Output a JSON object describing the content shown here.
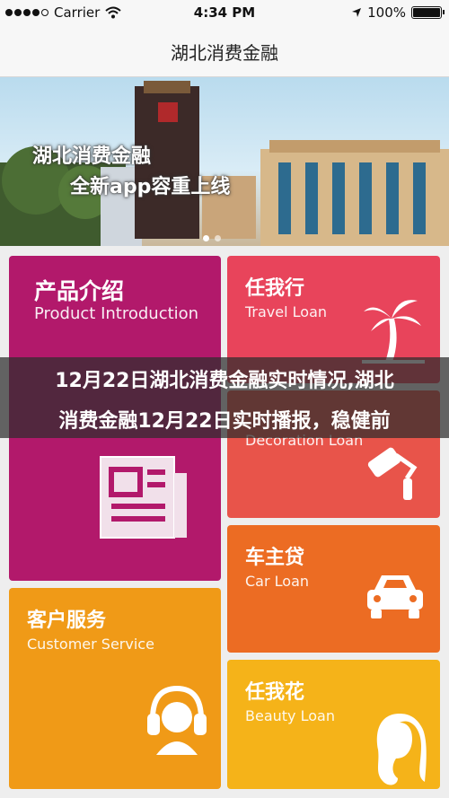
{
  "status_bar": {
    "carrier": "Carrier",
    "time": "4:34 PM",
    "battery": "100%"
  },
  "nav": {
    "title": "湖北消费金融"
  },
  "banner": {
    "line1": "湖北消费金融",
    "line2": "全新app容重上线"
  },
  "tiles": {
    "product": {
      "zh": "产品介绍",
      "en": "Product Introduction"
    },
    "travel": {
      "zh": "任我行",
      "en": "Travel Loan"
    },
    "decor": {
      "en": "Decoration Loan"
    },
    "car": {
      "zh": "车主贷",
      "en": "Car Loan"
    },
    "customer": {
      "zh": "客户服务",
      "en": "Customer Service"
    },
    "beauty": {
      "zh": "任我花",
      "en": "Beauty Loan"
    }
  },
  "overlay": {
    "line1": "12月22日湖北消费金融实时情况,湖北",
    "line2": "消费金融12月22日实时播报，稳健前"
  },
  "colors": {
    "product": "#b2196b",
    "travel": "#e8445b",
    "decor": "#e8544a",
    "car": "#ec6c23",
    "customer": "#f09a17",
    "beauty": "#f5b319"
  },
  "icons": {
    "product": "newspaper-icon",
    "travel": "palm-tree-icon",
    "decor": "paint-roller-icon",
    "car": "car-icon",
    "customer": "headset-icon",
    "beauty": "woman-face-icon"
  }
}
